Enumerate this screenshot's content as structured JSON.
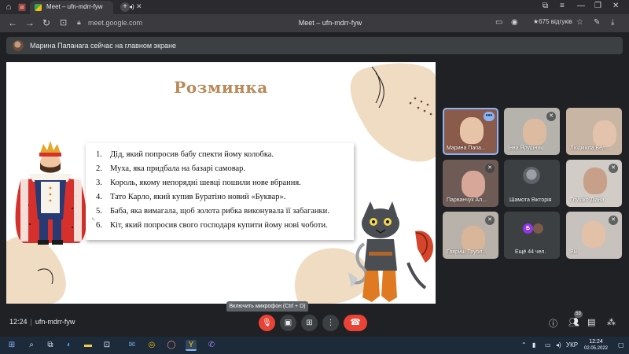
{
  "browser": {
    "tab_title": "Meet – ufn-mdrr-fyw",
    "url": "meet.google.com",
    "address_title": "Meet – ufn-mdrr-fyw",
    "reviews": "★675 відгуків"
  },
  "banner": {
    "text": "Марина Папанага сейчас на главном экране"
  },
  "slide": {
    "title": "Розминка",
    "items": [
      {
        "num": "1.",
        "text": "Дід, який попросив бабу спекти йому колобка."
      },
      {
        "num": "2.",
        "text": "Муха, яка придбала на базарі самовар."
      },
      {
        "num": "3.",
        "text": "Король, якому непорядні шевці пошили нове вбрання."
      },
      {
        "num": "4.",
        "text": "Тато Карло, який купив Буратіно новий «Буквар»."
      },
      {
        "num": "5.",
        "text": "Баба, яка вимагала, щоб золота рибка виконувала її забаганки."
      },
      {
        "num": "6.",
        "text": "Кіт, який попросив свого господаря купити йому нові чоботи."
      }
    ]
  },
  "participants": [
    {
      "name": "Марина Папа..."
    },
    {
      "name": "Інна Ярушник"
    },
    {
      "name": "Людмила Вел..."
    },
    {
      "name": "Парванчук Ал..."
    },
    {
      "name": "Шамота Вікторія"
    },
    {
      "name": "Глушко Діана"
    },
    {
      "name": "Гавриш Трубл..."
    },
    {
      "name": "Ещё 44 чел.",
      "avatar_letter": "Б"
    },
    {
      "name": "Вы"
    }
  ],
  "tooltip": "Включить микрофон (Ctrl + D)",
  "meeting": {
    "time": "12:24",
    "code": "ufn-mdrr-fyw",
    "people_count": "53"
  },
  "taskbar": {
    "lang": "УКР",
    "time": "12:24",
    "date": "02.05.2022"
  },
  "colors": {
    "accent_blue": "#8ab4f8",
    "danger_red": "#ea4335",
    "slide_title": "#b98a57",
    "blob_beige": "#f0dcc2"
  }
}
